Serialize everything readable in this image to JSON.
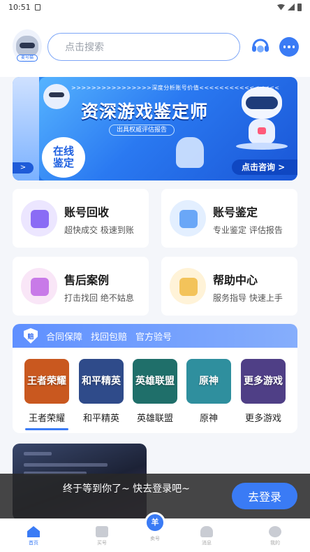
{
  "status_bar": {
    "time": "10:51"
  },
  "header": {
    "avatar_badge": "麦号猫",
    "search_placeholder": "点击搜索"
  },
  "banner": {
    "subtitle": ">>>>>>>>>>>>>>>>深度分析账号价值<<<<<<<<<<<<<<<<",
    "title": "资深游戏鉴定师",
    "tag": "出具权威评估报告",
    "circle_label": "在线鉴定",
    "consult_label": "点击咨询 >",
    "side_arrow": "<>"
  },
  "cards": [
    {
      "title": "账号回收",
      "desc": "超快成交 极速到账",
      "bg": "#ece6ff",
      "accent": "#8a6cf5",
      "icon": "star-bag-icon"
    },
    {
      "title": "账号鉴定",
      "desc": "专业鉴定 评估报告",
      "bg": "#e3efff",
      "accent": "#6aa7f7",
      "icon": "shield-check-icon"
    },
    {
      "title": "售后案例",
      "desc": "打击找回 绝不姑息",
      "bg": "#f9e6f7",
      "accent": "#c87ae8",
      "icon": "phone-shield-icon"
    },
    {
      "title": "帮助中心",
      "desc": "服务指导 快速上手",
      "bg": "#fff3d8",
      "accent": "#f3c35a",
      "icon": "guide-book-icon"
    }
  ],
  "guarantee": {
    "badge": "赔",
    "items": [
      "合同保障",
      "找回包赔",
      "官方验号"
    ]
  },
  "games": [
    {
      "name": "王者荣耀",
      "tile": "王者荣耀",
      "color": "#c9581f",
      "selected": true
    },
    {
      "name": "和平精英",
      "tile": "和平精英",
      "color": "#2f4b8a",
      "selected": false
    },
    {
      "name": "英雄联盟",
      "tile": "英雄联盟",
      "color": "#1f6f6a",
      "selected": false
    },
    {
      "name": "原神",
      "tile": "原神",
      "color": "#2f8f9e",
      "selected": false
    },
    {
      "name": "更多游戏",
      "tile": "更多游戏",
      "color": "#4f3f86",
      "selected": false
    }
  ],
  "toast": {
    "message": "终于等到你了~ 快去登录吧~",
    "login_label": "去登录"
  },
  "tabbar": [
    {
      "label": "首页",
      "icon": "home-icon"
    },
    {
      "label": "买号",
      "icon": "buy-icon"
    },
    {
      "label": "卖号",
      "icon": "sell-icon",
      "glyph": "羊"
    },
    {
      "label": "消息",
      "icon": "bell-icon"
    },
    {
      "label": "我的",
      "icon": "profile-icon"
    }
  ]
}
